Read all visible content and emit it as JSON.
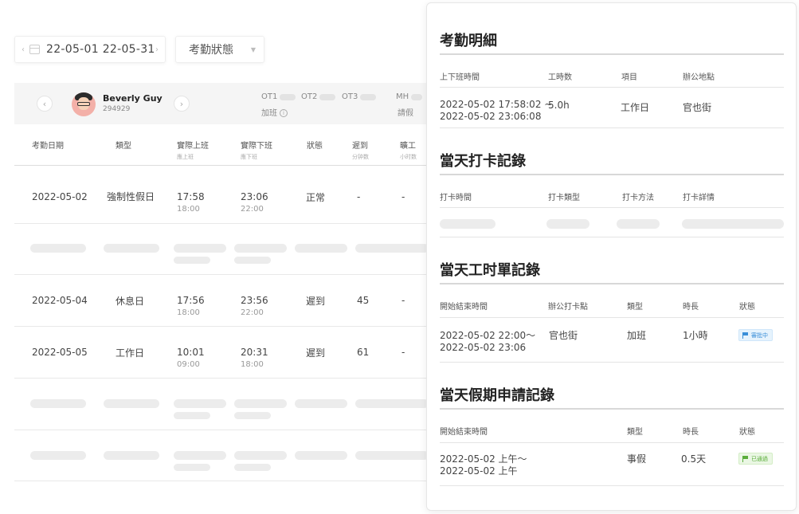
{
  "filters": {
    "date_range": "22-05-01 22-05-31",
    "status_placeholder": "考勤狀態"
  },
  "employee": {
    "name": "Beverly Guy",
    "id": "294929",
    "ot1_label": "OT1",
    "ot2_label": "OT2",
    "ot3_label": "OT3",
    "mh_label": "MH",
    "overtime_label": "加班",
    "leave_label": "請假"
  },
  "table": {
    "columns": [
      {
        "label": "考勤日期",
        "sub": ""
      },
      {
        "label": "類型",
        "sub": ""
      },
      {
        "label": "實際上班",
        "sub": "應上班"
      },
      {
        "label": "實際下班",
        "sub": "應下班"
      },
      {
        "label": "狀態",
        "sub": ""
      },
      {
        "label": "遲到",
        "sub": "分钟数"
      },
      {
        "label": "曠工",
        "sub": "小时数"
      }
    ],
    "rows": [
      {
        "date": "2022-05-02",
        "type": "強制性假日",
        "in": "17:58",
        "in_sched": "18:00",
        "out": "23:06",
        "out_sched": "22:00",
        "status": "正常",
        "late": "-",
        "absent": "-"
      },
      {
        "date": "2022-05-04",
        "type": "休息日",
        "in": "17:56",
        "in_sched": "18:00",
        "out": "23:56",
        "out_sched": "22:00",
        "status": "遲到",
        "late": "45",
        "absent": "-"
      },
      {
        "date": "2022-05-05",
        "type": "工作日",
        "in": "10:01",
        "in_sched": "09:00",
        "out": "20:31",
        "out_sched": "18:00",
        "status": "遲到",
        "late": "61",
        "absent": "-"
      }
    ]
  },
  "panel": {
    "detail": {
      "title": "考勤明細",
      "headers": [
        "上下班時間",
        "工時数",
        "項目",
        "辦公地點"
      ],
      "row": {
        "time_start": "2022-05-02 17:58:02 ~",
        "time_end": "2022-05-02  23:06:08",
        "hours": "5.0h",
        "item": "工作日",
        "location": "官也街"
      }
    },
    "punch": {
      "title": "當天打卡記錄",
      "headers": [
        "打卡時間",
        "打卡類型",
        "打卡方法",
        "打卡詳情"
      ]
    },
    "worksheet": {
      "title": "當天工时單記錄",
      "headers": [
        "開始結束時間",
        "辦公打卡點",
        "類型",
        "時長",
        "狀態"
      ],
      "row": {
        "time_start": "2022-05-02 22:00～",
        "time_end": "2022-05-02 23:06",
        "location": "官也街",
        "type": "加班",
        "duration": "1小時",
        "status": "審批中"
      }
    },
    "leave": {
      "title": "當天假期申請記錄",
      "headers": [
        "開始結束時間",
        "類型",
        "時長",
        "狀態"
      ],
      "row": {
        "time_start": "2022-05-02  上午～",
        "time_end": "2022-05-02  上午",
        "type": "事假",
        "duration": "0.5天",
        "status": "已通過"
      }
    }
  },
  "colors": {
    "review": "#3a8fd8",
    "approved": "#5aad3a",
    "skeleton": "#ececec"
  }
}
